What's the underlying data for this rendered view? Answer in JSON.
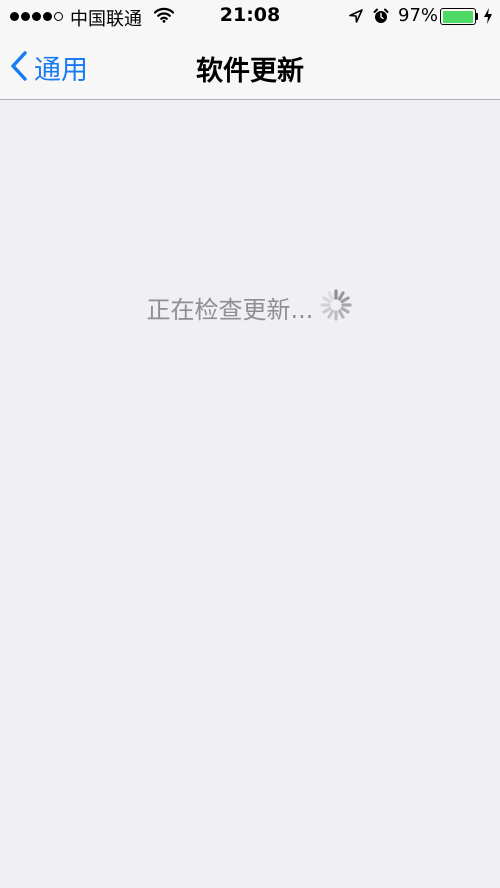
{
  "status_bar": {
    "carrier": "中国联通",
    "time": "21:08",
    "battery_percent": "97%",
    "battery_level": 0.97,
    "signal_strength": 4,
    "accent_battery": "#4cd964"
  },
  "nav": {
    "back_label": "通用",
    "title": "软件更新",
    "accent": "#1a7cf2"
  },
  "main": {
    "loading_text": "正在检查更新..."
  }
}
